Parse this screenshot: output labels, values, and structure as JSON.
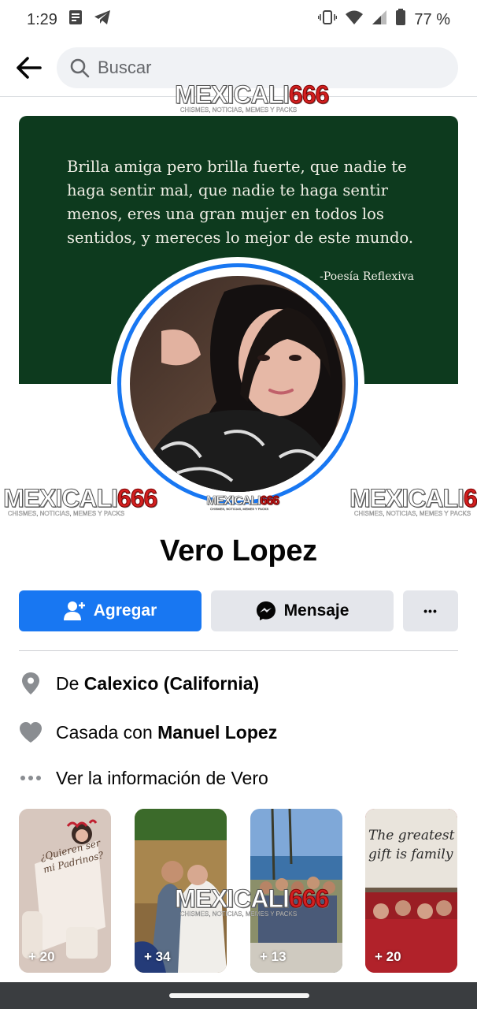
{
  "status_bar": {
    "time": "1:29",
    "battery": "77 %"
  },
  "search": {
    "placeholder": "Buscar"
  },
  "cover": {
    "quote": "Brilla amiga pero brilla fuerte, que nadie te haga sentir mal, que nadie te haga sentir menos, eres una gran mujer en todos los sentidos, y mereces lo mejor de este mundo.",
    "author": "-Poesía Reflexiva"
  },
  "watermark": {
    "main": "MEXICALI",
    "number": "666",
    "sub": "CHISMES, NOTICIAS, MEMES Y PACKS"
  },
  "profile": {
    "name": "Vero Lopez"
  },
  "actions": {
    "add_label": "Agregar",
    "message_label": "Mensaje",
    "more_label": "•••"
  },
  "info": {
    "from_prefix": "De ",
    "from_value": "Calexico (California)",
    "married_prefix": "Casada con ",
    "married_value": "Manuel Lopez",
    "see_info": "Ver la información de Vero"
  },
  "stories": [
    {
      "count": "+ 20",
      "text": "¿Quieren ser mi Padrinos?"
    },
    {
      "count": "+ 34"
    },
    {
      "count": "+ 13"
    },
    {
      "count": "+ 20",
      "text": "The greatest gift is family"
    }
  ],
  "colors": {
    "facebook_blue": "#1877f2",
    "cover_green": "#0d3a1e",
    "button_grey": "#e4e6eb"
  }
}
